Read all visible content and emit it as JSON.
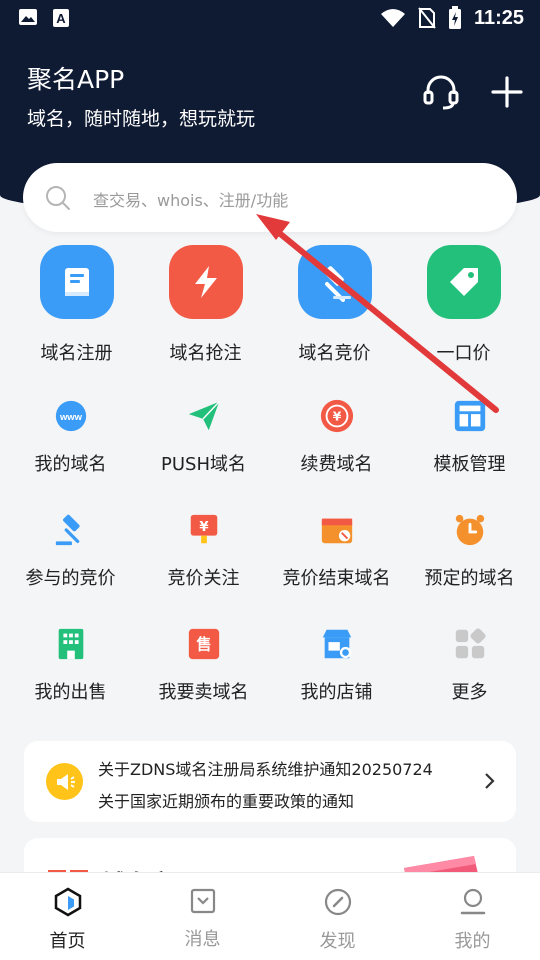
{
  "status_bar": {
    "time": "11:25"
  },
  "header": {
    "title": "聚名APP",
    "subtitle": "域名，随时随地，想玩就玩"
  },
  "search": {
    "placeholder": "查交易、whois、注册/功能"
  },
  "quick_actions": [
    {
      "label": "域名注册",
      "icon": "book-icon",
      "color": "#3a9cf6"
    },
    {
      "label": "域名抢注",
      "icon": "lightning-icon",
      "color": "#f25a46"
    },
    {
      "label": "域名竞价",
      "icon": "gavel-icon",
      "color": "#3a9cf6"
    },
    {
      "label": "一口价",
      "icon": "price-tag-icon",
      "color": "#23c07c"
    }
  ],
  "menu_items": [
    {
      "label": "我的域名",
      "icon": "www-globe-icon"
    },
    {
      "label": "PUSH域名",
      "icon": "paper-plane-icon"
    },
    {
      "label": "续费域名",
      "icon": "yen-coin-icon"
    },
    {
      "label": "模板管理",
      "icon": "template-icon"
    },
    {
      "label": "参与的竞价",
      "icon": "gavel-icon"
    },
    {
      "label": "竞价关注",
      "icon": "yen-sign-icon"
    },
    {
      "label": "竞价结束域名",
      "icon": "wallet-icon"
    },
    {
      "label": "预定的域名",
      "icon": "alarm-clock-icon"
    },
    {
      "label": "我的出售",
      "icon": "building-icon"
    },
    {
      "label": "我要卖域名",
      "icon": "sell-tag-icon"
    },
    {
      "label": "我的店铺",
      "icon": "shop-icon"
    },
    {
      "label": "更多",
      "icon": "more-grid-icon"
    }
  ],
  "notice": {
    "lines": [
      "关于ZDNS域名注册局系统维护通知20250724",
      "关于国家近期颁布的重要政策的通知"
    ]
  },
  "promo_card": {
    "text": "域名交易"
  },
  "tabs": [
    {
      "label": "首页",
      "icon": "home-hexagon-icon",
      "active": true
    },
    {
      "label": "消息",
      "icon": "message-box-icon",
      "active": false
    },
    {
      "label": "发现",
      "icon": "compass-icon",
      "active": false
    },
    {
      "label": "我的",
      "icon": "user-icon",
      "active": false
    }
  ],
  "colors": {
    "header_bg": "#0f1a33",
    "accent_red": "#f25a46",
    "accent_blue": "#3a9cf6",
    "accent_green": "#23c07c",
    "notice_yellow": "#ffc31a"
  }
}
